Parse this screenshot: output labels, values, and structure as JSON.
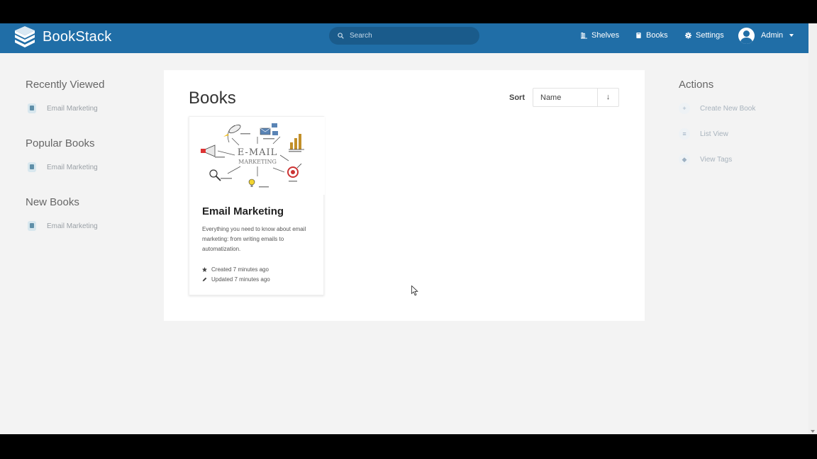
{
  "header": {
    "app_name": "BookStack",
    "search_placeholder": "Search",
    "nav": {
      "shelves": "Shelves",
      "books": "Books",
      "settings": "Settings"
    },
    "user": "Admin",
    "color": "#206ea7"
  },
  "left": {
    "recently_viewed": {
      "title": "Recently Viewed",
      "items": [
        "Email Marketing"
      ]
    },
    "popular_books": {
      "title": "Popular Books",
      "items": [
        "Email Marketing"
      ]
    },
    "new_books": {
      "title": "New Books",
      "items": [
        "Email Marketing"
      ]
    }
  },
  "main": {
    "title": "Books",
    "sort_label": "Sort",
    "sort_value": "Name",
    "sort_direction": "↓",
    "books": [
      {
        "title": "Email Marketing",
        "description": "Everything you need to know about email marketing: from writing emails to automatization.",
        "created": "Created 7 minutes ago",
        "updated": "Updated 7 minutes ago",
        "cover_text": [
          "E-MAIL",
          "MARKETING"
        ]
      }
    ]
  },
  "actions": {
    "title": "Actions",
    "items": [
      "Create New Book",
      "List View",
      "View Tags"
    ]
  }
}
